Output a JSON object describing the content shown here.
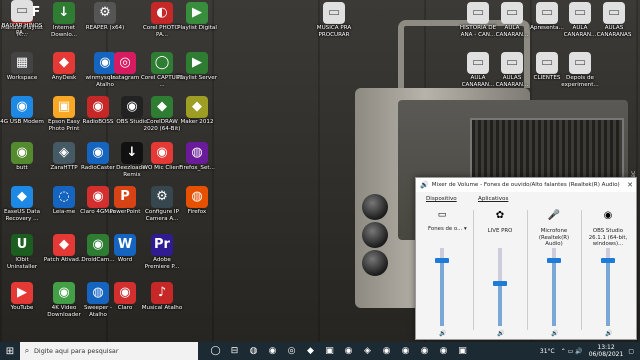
{
  "desktop": {
    "icons": [
      {
        "label": "Manual Playlist M...",
        "glyph": "PDF",
        "bg": "#d32f2f"
      },
      {
        "label": "Internet Downlo...",
        "glyph": "↓",
        "bg": "#2e7d32"
      },
      {
        "label": "REAPER (x64)",
        "glyph": "⚙",
        "bg": "#555"
      },
      {
        "label": "Corel PHOTO-PA...",
        "glyph": "◐",
        "bg": "#c62828"
      },
      {
        "label": "Playlist Digital",
        "glyph": "▶",
        "bg": "#388e3c"
      },
      {
        "label": "Workspace",
        "glyph": "▦",
        "bg": "#444"
      },
      {
        "label": "AnyDesk",
        "glyph": "◆",
        "bg": "#e53935"
      },
      {
        "label": "winmysqla... - Atalho",
        "glyph": "◉",
        "bg": "#1565c0"
      },
      {
        "label": "Instagram",
        "glyph": "◎",
        "bg": "#d81b60"
      },
      {
        "label": "Corel CAPTURE ...",
        "glyph": "◯",
        "bg": "#2e7d32"
      },
      {
        "label": "Playlist Server",
        "glyph": "▶",
        "bg": "#2e7d32"
      },
      {
        "label": "4G USB Modem",
        "glyph": "◉",
        "bg": "#1e88e5"
      },
      {
        "label": "Epson Easy Photo Print",
        "glyph": "▣",
        "bg": "#f9a825"
      },
      {
        "label": "RadioBOSS",
        "glyph": "◉",
        "bg": "#c62828"
      },
      {
        "label": "OBS Studio",
        "glyph": "◉",
        "bg": "#222"
      },
      {
        "label": "CorelDRAW 2020 (64-Bit)",
        "glyph": "◆",
        "bg": "#2e7d32"
      },
      {
        "label": "Maker 2012",
        "glyph": "◆",
        "bg": "#9e9d24"
      },
      {
        "label": "butt",
        "glyph": "◉",
        "bg": "#558b2f"
      },
      {
        "label": "ZaraHTTP",
        "glyph": "◈",
        "bg": "#455a64"
      },
      {
        "label": "RadioCaster",
        "glyph": "◉",
        "bg": "#1565c0"
      },
      {
        "label": "Deezloader Remix",
        "glyph": "↓",
        "bg": "#111"
      },
      {
        "label": "WO Mic Client",
        "glyph": "◉",
        "bg": "#e53935"
      },
      {
        "label": "Firefox_Set...",
        "glyph": "◍",
        "bg": "#6a1b9a"
      },
      {
        "label": "EaseUS Data Recovery ...",
        "glyph": "◆",
        "bg": "#1e88e5"
      },
      {
        "label": "Leia-me",
        "glyph": "◌",
        "bg": "#1565c0"
      },
      {
        "label": "Claro 4GMax",
        "glyph": "◉",
        "bg": "#d32f2f"
      },
      {
        "label": "PowerPoint",
        "glyph": "P",
        "bg": "#d84315"
      },
      {
        "label": "Configure IP Camera A...",
        "glyph": "⚙",
        "bg": "#37474f"
      },
      {
        "label": "Firefox",
        "glyph": "◍",
        "bg": "#e65100"
      },
      {
        "label": "IObit Uninstaller",
        "glyph": "U",
        "bg": "#1b5e20"
      },
      {
        "label": "Patch Ativad...",
        "glyph": "◆",
        "bg": "#e53935"
      },
      {
        "label": "DroidCam...",
        "glyph": "◉",
        "bg": "#2e7d32"
      },
      {
        "label": "Word",
        "glyph": "W",
        "bg": "#1565c0"
      },
      {
        "label": "Adobe Premiere P...",
        "glyph": "Pr",
        "bg": "#311b92"
      },
      {
        "label": "YouTube",
        "glyph": "▶",
        "bg": "#e53935"
      },
      {
        "label": "4K Video Downloader",
        "glyph": "◉",
        "bg": "#43a047"
      },
      {
        "label": "Sweeper - Atalho",
        "glyph": "◍",
        "bg": "#1565c0"
      },
      {
        "label": "Claro",
        "glyph": "◉",
        "bg": "#d32f2f"
      },
      {
        "label": "Musical Atalho",
        "glyph": "♪",
        "bg": "#c62828"
      },
      {
        "label": "MUSICA PRA PROCURAR",
        "glyph": "▭",
        "bg": "#e0e0e0"
      },
      {
        "label": "HISTORIA DE ANA - CAN...",
        "glyph": "▭",
        "bg": "#e0e0e0"
      },
      {
        "label": "AULA CANARAN...",
        "glyph": "▭",
        "bg": "#e0e0e0"
      },
      {
        "label": "Apresenta...",
        "glyph": "▭",
        "bg": "#e0e0e0"
      },
      {
        "label": "AULA CANARAN...",
        "glyph": "▭",
        "bg": "#e0e0e0"
      },
      {
        "label": "AULAS CANARANAS",
        "glyph": "▭",
        "bg": "#e0e0e0"
      },
      {
        "label": "AULA CANARAN...",
        "glyph": "▭",
        "bg": "#e0e0e0"
      },
      {
        "label": "AULAS CANARAN...",
        "glyph": "▭",
        "bg": "#e0e0e0"
      },
      {
        "label": "CLIENTES",
        "glyph": "▭",
        "bg": "#e0e0e0"
      },
      {
        "label": "Depois de experiment...",
        "glyph": "▭",
        "bg": "#e0e0e0"
      },
      {
        "label": "BAIXAR HINOS PA...",
        "glyph": "▭",
        "bg": "#e0e0e0"
      }
    ],
    "watermark": "screenrec"
  },
  "mixer": {
    "title": "Mixer de Volume - Fones de ouvido/Alto falantes (Realtek(R) Audio)",
    "close_glyph": "✕",
    "section_device": "Dispositivo",
    "section_apps": "Aplicativos",
    "device": {
      "label": "Fones de o...",
      "level": 0.85
    },
    "apps": [
      {
        "label": "LIVE PRO",
        "glyph": "✿",
        "level": 0.55
      },
      {
        "label": "Microfone (Realtek(R) Audio)",
        "glyph": "🎤",
        "level": 0.85
      },
      {
        "label": "OBS Studio 26.1.1 (64-bit, windows)...",
        "glyph": "◉",
        "level": 0.85
      }
    ]
  },
  "taskbar": {
    "start_glyph": "⊞",
    "search_placeholder": "Digite aqui para pesquisar",
    "apps": [
      "◯",
      "⊟",
      "◍",
      "◉",
      "◎",
      "◆",
      "▣",
      "◉",
      "◈",
      "◉",
      "◉",
      "◉",
      "◉",
      "▣"
    ],
    "weather": "31°C",
    "time": "13:12",
    "date": "06/08/2021"
  }
}
